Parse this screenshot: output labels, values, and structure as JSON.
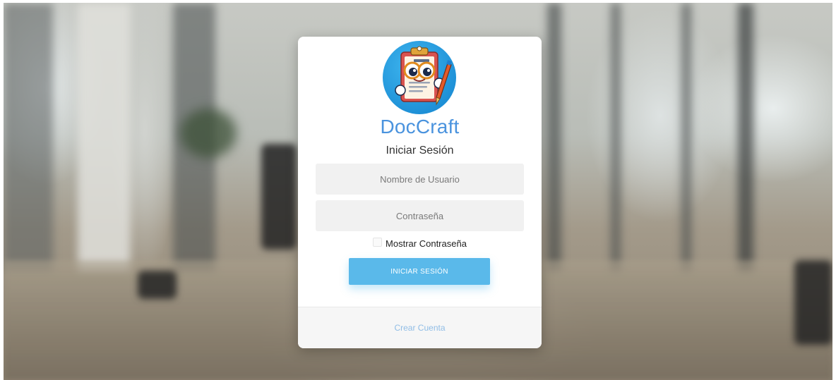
{
  "login": {
    "brand": "DocCraft",
    "title": "Iniciar Sesión",
    "username_placeholder": "Nombre de Usuario",
    "username_value": "",
    "password_placeholder": "Contraseña",
    "password_value": "",
    "show_password_label": "Mostrar Contraseña",
    "show_password_checked": false,
    "submit_label": "INICIAR SESIÓN",
    "create_account_label": "Crear Cuenta"
  },
  "colors": {
    "brand": "#4a93de",
    "button": "#5ab9ea",
    "link": "#90bde6",
    "field_bg": "#f1f1f1"
  },
  "icons": {
    "logo": "clipboard-mascot-icon"
  }
}
